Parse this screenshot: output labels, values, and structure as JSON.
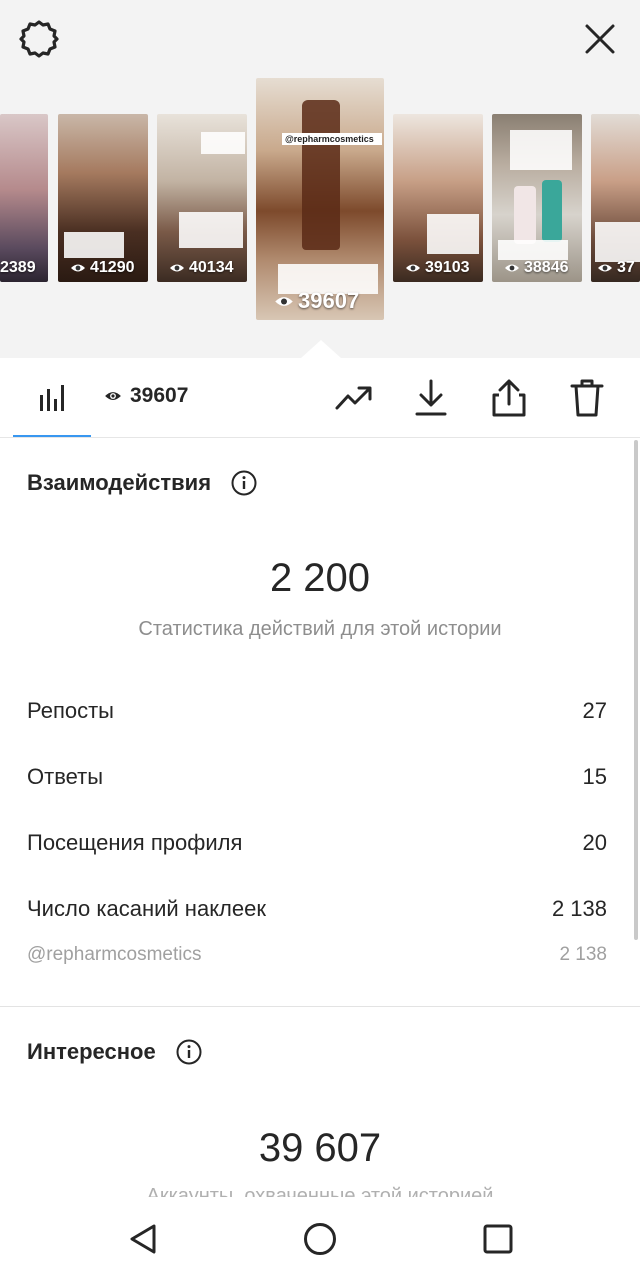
{
  "top": {
    "stories": [
      {
        "views": "2389"
      },
      {
        "views": "41290"
      },
      {
        "views": "40134"
      },
      {
        "views": "39607",
        "tag": "@repharmcosmetics"
      },
      {
        "views": "39103"
      },
      {
        "views": "38846"
      },
      {
        "views": "37"
      }
    ]
  },
  "tabbar": {
    "views_count": "39607"
  },
  "interactions": {
    "title": "Взаимодействия",
    "total": "2 200",
    "subtitle": "Статистика действий для этой истории",
    "rows": [
      {
        "label": "Репосты",
        "value": "27"
      },
      {
        "label": "Ответы",
        "value": "15"
      },
      {
        "label": "Посещения профиля",
        "value": "20"
      },
      {
        "label": "Число касаний наклеек",
        "value": "2 138"
      }
    ],
    "sticker_row": {
      "label": "@repharmcosmetics",
      "value": "2 138"
    }
  },
  "discovery": {
    "title": "Интересное",
    "total": "39 607",
    "subtitle_partial": "Аккаунты, охваченные этой историей"
  },
  "colors": {
    "accent": "#3897f0",
    "muted": "#8e8e8e"
  }
}
